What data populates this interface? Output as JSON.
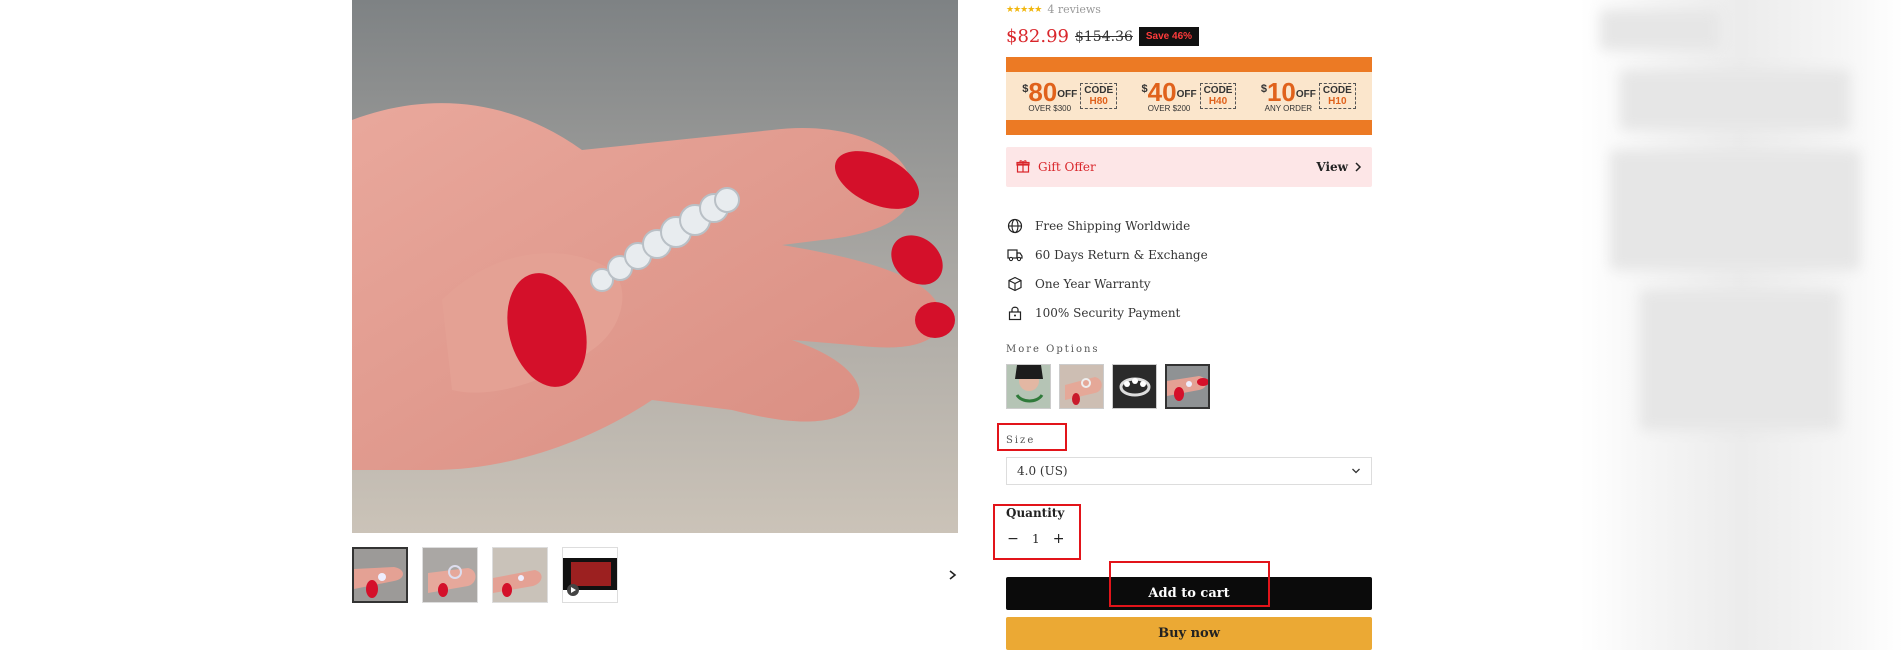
{
  "product": {
    "rating": {
      "stars": "★★★★★",
      "reviews": "4 reviews"
    },
    "price": {
      "current": "$82.99",
      "original": "$154.36",
      "save": "Save 46%"
    }
  },
  "coupons": [
    {
      "dollar": "$",
      "amount": "80",
      "off": "OFF",
      "sub": "OVER $300",
      "code_label": "CODE",
      "code": "H80"
    },
    {
      "dollar": "$",
      "amount": "40",
      "off": "OFF",
      "sub": "OVER $200",
      "code_label": "CODE",
      "code": "H40"
    },
    {
      "dollar": "$",
      "amount": "10",
      "off": "OFF",
      "sub": "ANY ORDER",
      "code_label": "CODE",
      "code": "H10"
    }
  ],
  "gift": {
    "label": "Gift Offer",
    "view": "View"
  },
  "features": [
    {
      "icon": "globe-icon",
      "text": "Free Shipping Worldwide"
    },
    {
      "icon": "truck-icon",
      "text": "60 Days Return & Exchange"
    },
    {
      "icon": "box-icon",
      "text": "One Year Warranty"
    },
    {
      "icon": "lock-icon",
      "text": "100% Security Payment"
    }
  ],
  "more_options": {
    "label": "More Options"
  },
  "size": {
    "label": "Size",
    "selected": "4.0 (US)"
  },
  "quantity": {
    "label": "Quantity",
    "value": "1",
    "minus": "−",
    "plus": "+"
  },
  "actions": {
    "add_to_cart": "Add to cart",
    "buy_now": "Buy now"
  },
  "colors": {
    "price_red": "#d9262b",
    "banner_orange": "#ec7a24",
    "buy_now": "#eba934",
    "annotation": "#e2141a"
  }
}
